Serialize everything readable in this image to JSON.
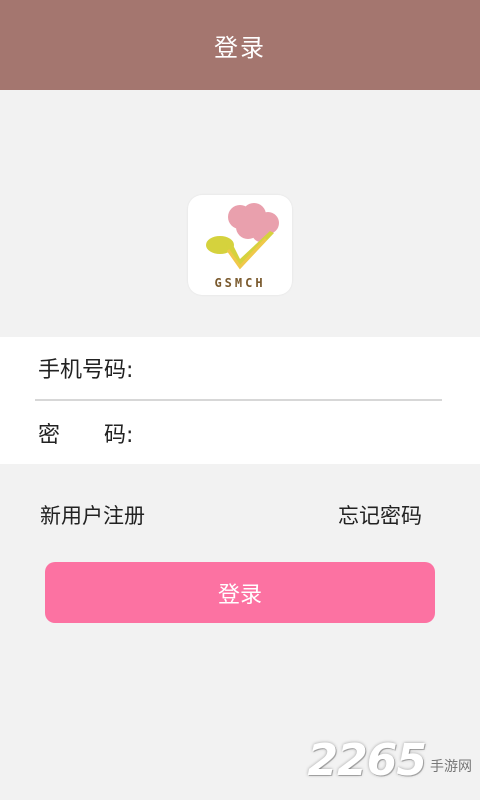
{
  "header": {
    "title": "登录"
  },
  "logo": {
    "text": "GSMCH"
  },
  "form": {
    "phone_label": "手机号码:",
    "phone_value": "",
    "password_label": "密　　码:",
    "password_value": ""
  },
  "links": {
    "register": "新用户注册",
    "forgot": "忘记密码"
  },
  "login_button": {
    "label": "登录"
  },
  "watermark": {
    "number": "2265",
    "text": "手游网"
  },
  "colors": {
    "header": "#a4766f",
    "button": "#fc72a2",
    "background": "#f2f2f2"
  }
}
